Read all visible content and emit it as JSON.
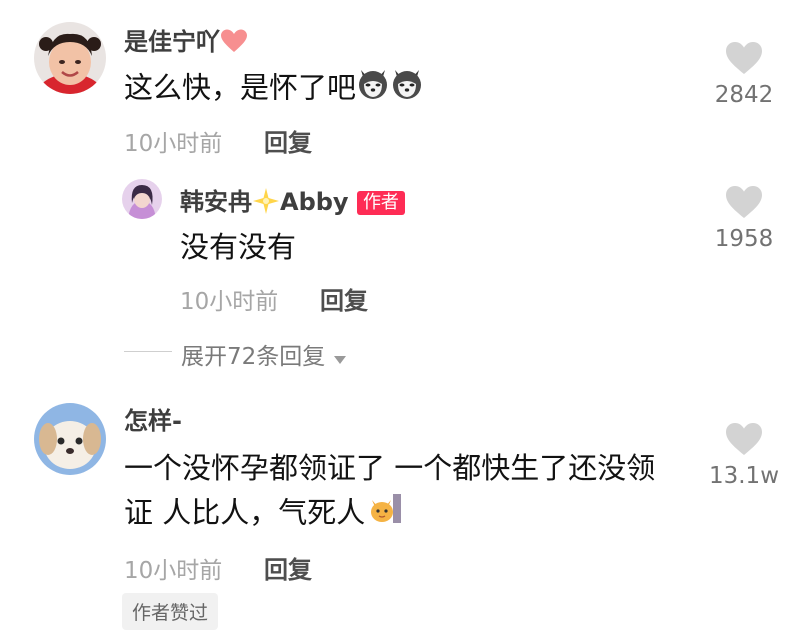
{
  "comments": [
    {
      "username": "是佳宁吖",
      "name_emoji": "heart-emoji",
      "text": "这么快，是怀了吧",
      "text_emojis": [
        "husky-emoji",
        "husky-emoji"
      ],
      "time": "10小时前",
      "reply_label": "回复",
      "likes": "2842",
      "reply": {
        "username": "韩安冉",
        "name_emoji": "sparkle-star-emoji",
        "username_suffix": "Abby",
        "author_tag": "作者",
        "text": "没有没有",
        "time": "10小时前",
        "reply_label": "回复",
        "likes": "1958"
      },
      "expand_label": "展开72条回复"
    },
    {
      "username": "怎样-",
      "text_line1": "一个没怀孕都领证了 一个都快生了还没领",
      "text_line2": "证 人比人，气死人",
      "text_emoji": "cat-emoji",
      "time": "10小时前",
      "reply_label": "回复",
      "likes": "13.1w",
      "liked_by_author": "作者赞过"
    }
  ],
  "colors": {
    "author_tag_bg": "#fe2c55",
    "heart_gray": "#d3d3d3",
    "meta_gray": "#a6a6a6"
  }
}
